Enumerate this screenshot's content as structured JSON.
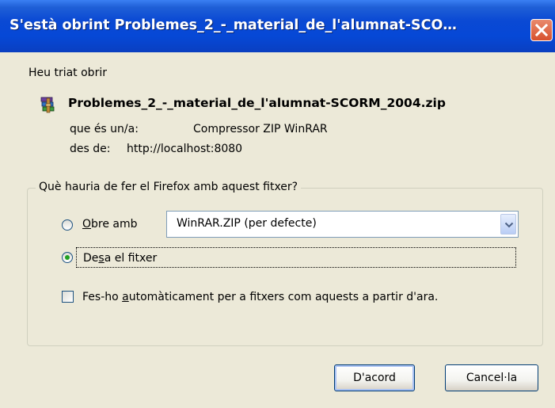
{
  "window": {
    "title": "S'està obrint Problemes_2_-_material_de_l'alumnat-SCO…"
  },
  "intro_text": "Heu triat obrir",
  "file": {
    "name": "Problemes_2_-_material_de_l'alumnat-SCORM_2004.zip",
    "icon": "winrar-archive-icon",
    "type_label": "que és un/a:",
    "type_value": "Compressor ZIP WinRAR",
    "from_label": "des de:",
    "from_value": "http://localhost:8080"
  },
  "action_group": {
    "legend": "Què hauria de fer el Firefox amb aquest fitxer?",
    "open_with": {
      "label_first": "O",
      "label_rest": "bre amb",
      "selected": false,
      "app_value": "WinRAR.ZIP (per defecte)"
    },
    "save_file": {
      "label_pre": "De",
      "label_mnemonic": "s",
      "label_post": "a el fitxer",
      "selected": true
    },
    "auto": {
      "label_pre": "Fes-ho ",
      "label_mnemonic": "a",
      "label_post": "utomàticament per a fitxers com aquests a partir d'ara.",
      "checked": false
    }
  },
  "buttons": {
    "ok": "D'acord",
    "cancel": "Cancel·la"
  },
  "colors": {
    "titlebar": "#0a49d4",
    "dialog_bg": "#ece9d8",
    "radio_dot": "#21a121",
    "close_button": "#d7512e"
  }
}
